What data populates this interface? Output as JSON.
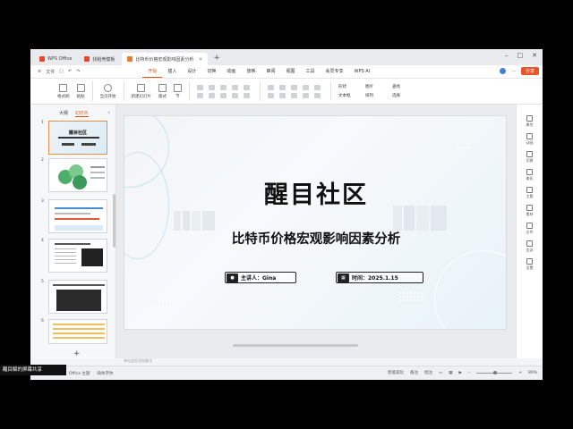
{
  "tabs": [
    {
      "label": "WPS Office",
      "color": "#e8452a"
    },
    {
      "label": "找稻壳模板",
      "color": "#e8452a"
    },
    {
      "label": "比特币价格宏观影响因素分析",
      "color": "#e87c2a"
    }
  ],
  "menu": {
    "file": "文件",
    "items": [
      "开始",
      "插入",
      "设计",
      "切换",
      "动画",
      "放映",
      "审阅",
      "视图",
      "工具",
      "会员专享",
      "WPS AI"
    ],
    "active_index": 0,
    "share": "分享"
  },
  "ribbon": {
    "groups": [
      "格式刷",
      "粘贴",
      "当页开始",
      "新建幻灯片",
      "版式",
      "节"
    ],
    "right": [
      "形状",
      "图片",
      "文本框",
      "排列",
      "查找",
      "选择"
    ]
  },
  "left_panel": {
    "tab_outline": "大纲",
    "tab_slides": "幻灯片",
    "slide_numbers": [
      "1",
      "2",
      "3",
      "4",
      "5",
      "6"
    ]
  },
  "slide": {
    "title": "醒目社区",
    "subtitle": "比特币价格宏观影响因素分析",
    "presenter": "主讲人：Gina",
    "date": "时间：2025.1.15"
  },
  "notes_placeholder": "单击此处添加备注",
  "right_panel": [
    "属性",
    "动画",
    "切换",
    "美化",
    "主题",
    "素材",
    "文件",
    "会议",
    "设置"
  ],
  "status": {
    "slide_count": "1 / 34",
    "theme": "Office 主题",
    "missing_font": "缺失字体",
    "smart_beautify": "智能美化",
    "notes": "备注",
    "comments": "批注",
    "zoom": "89%"
  },
  "share_banner": "醒目解的屏幕共享"
}
